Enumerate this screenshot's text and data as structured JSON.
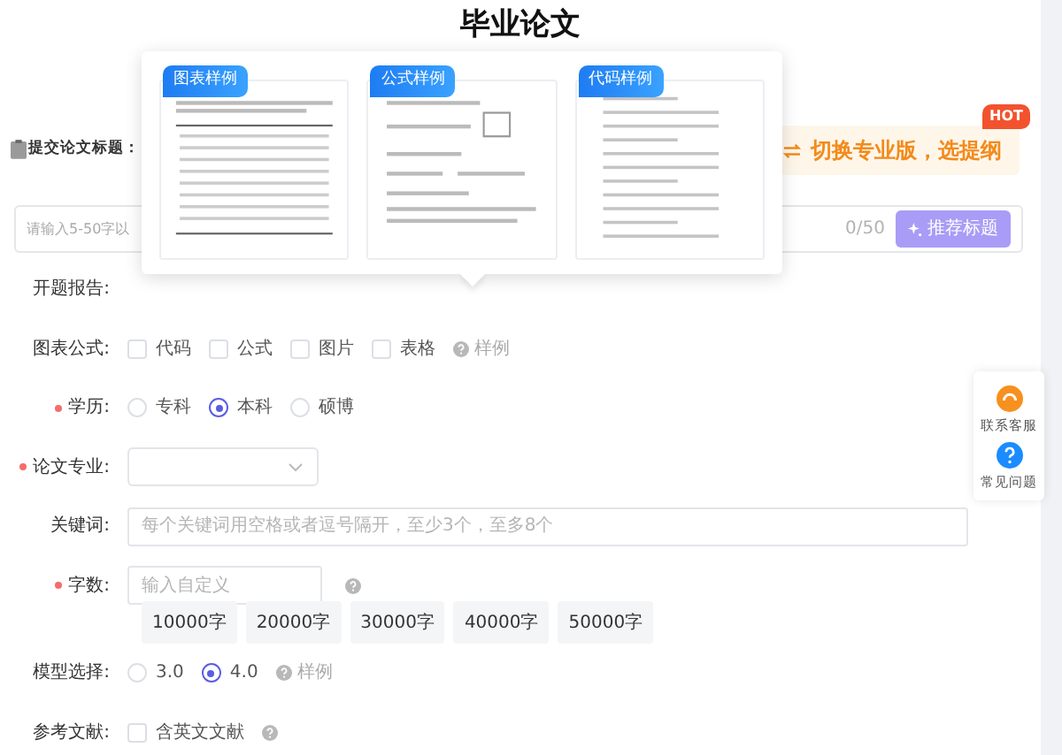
{
  "title": "毕业论文",
  "title_field": {
    "label": "提交论文标题：",
    "placeholder": "请输入5-50字以",
    "counter": "0/50",
    "button": "推荐标题"
  },
  "promo": {
    "text": "切换专业版，选提纲",
    "badge": "HOT"
  },
  "samples_popup": [
    {
      "label": "图表样例",
      "kind": "table"
    },
    {
      "label": "公式样例",
      "kind": "formula"
    },
    {
      "label": "代码样例",
      "kind": "code"
    }
  ],
  "form": [
    {
      "kind": "plain",
      "label": "开题报告:",
      "required": false
    },
    {
      "kind": "checks",
      "label": "图表公式:",
      "required": false,
      "options": [
        {
          "text": "代码",
          "checked": false
        },
        {
          "text": "公式",
          "checked": false
        },
        {
          "text": "图片",
          "checked": false
        },
        {
          "text": "表格",
          "checked": false
        }
      ],
      "sample_link": "样例"
    },
    {
      "kind": "radios",
      "label": "学历:",
      "required": true,
      "options": [
        {
          "text": "专科",
          "selected": false
        },
        {
          "text": "本科",
          "selected": true
        },
        {
          "text": "硕博",
          "selected": false
        }
      ]
    },
    {
      "kind": "select",
      "label": "论文专业:",
      "required": true
    },
    {
      "kind": "text",
      "label": "关键词:",
      "required": false,
      "placeholder": "每个关键词用空格或者逗号隔开，至少3个，至多8个"
    },
    {
      "kind": "words",
      "label": "字数:",
      "required": true,
      "placeholder": "输入自定义",
      "help": true,
      "chips": [
        "10000字",
        "20000字",
        "30000字",
        "40000字",
        "50000字"
      ]
    },
    {
      "kind": "radios",
      "label": "模型选择:",
      "required": false,
      "options": [
        {
          "text": "3.0",
          "selected": false
        },
        {
          "text": "4.0",
          "selected": true
        }
      ],
      "sample_link": "样例"
    },
    {
      "kind": "checks",
      "label": "参考文献:",
      "required": false,
      "options": [
        {
          "text": "含英文文献",
          "checked": false
        }
      ],
      "help": true
    }
  ],
  "side_panel": [
    {
      "label": "联系客服",
      "kind": "service"
    },
    {
      "label": "常见问题",
      "kind": "faq"
    }
  ]
}
